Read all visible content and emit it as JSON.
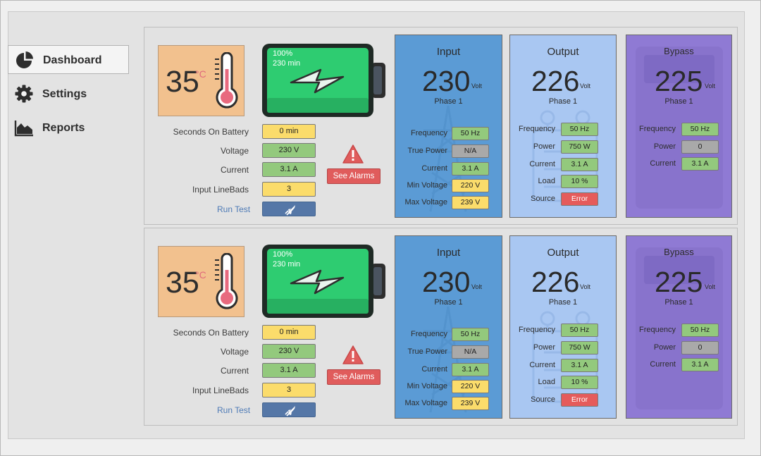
{
  "sidebar": {
    "items": [
      {
        "label": "Dashboard",
        "icon": "pie-chart-icon",
        "active": true
      },
      {
        "label": "Settings",
        "icon": "gear-icon",
        "active": false
      },
      {
        "label": "Reports",
        "icon": "area-chart-icon",
        "active": false
      }
    ]
  },
  "ups": [
    {
      "temperature": {
        "value": "35",
        "unit": "°C"
      },
      "battery": {
        "percent": "100%",
        "runtime": "230 min",
        "charge_fraction": 1.0
      },
      "stats": [
        {
          "label": "Seconds On Battery",
          "value": "0 min",
          "status": "yellow"
        },
        {
          "label": "Voltage",
          "value": "230 V",
          "status": "green"
        },
        {
          "label": "Current",
          "value": "3.1 A",
          "status": "green"
        },
        {
          "label": "Input LineBads",
          "value": "3",
          "status": "yellow"
        }
      ],
      "run_test": "Run Test",
      "alarms_label": "See Alarms",
      "input": {
        "title": "Input",
        "value": "230",
        "unit": "Volt",
        "phase": "Phase 1",
        "rows": [
          {
            "label": "Frequency",
            "value": "50 Hz",
            "status": "green"
          },
          {
            "label": "True Power",
            "value": "N/A",
            "status": "gray"
          },
          {
            "label": "Current",
            "value": "3.1 A",
            "status": "green"
          },
          {
            "label": "Min Voltage",
            "value": "220 V",
            "status": "yellow"
          },
          {
            "label": "Max Voltage",
            "value": "239 V",
            "status": "yellow"
          }
        ]
      },
      "output": {
        "title": "Output",
        "value": "226",
        "unit": "Volt",
        "phase": "Phase 1",
        "rows": [
          {
            "label": "Frequency",
            "value": "50 Hz",
            "status": "green"
          },
          {
            "label": "Power",
            "value": "750 W",
            "status": "green"
          },
          {
            "label": "Current",
            "value": "3.1 A",
            "status": "green"
          },
          {
            "label": "Load",
            "value": "10 %",
            "status": "green"
          },
          {
            "label": "Source",
            "value": "Error",
            "status": "red"
          }
        ]
      },
      "bypass": {
        "title": "Bypass",
        "value": "225",
        "unit": "Volt",
        "phase": "Phase 1",
        "rows": [
          {
            "label": "Frequency",
            "value": "50 Hz",
            "status": "green"
          },
          {
            "label": "Power",
            "value": "0",
            "status": "gray"
          },
          {
            "label": "Current",
            "value": "3.1 A",
            "status": "green"
          }
        ]
      }
    },
    {
      "temperature": {
        "value": "35",
        "unit": "°C"
      },
      "battery": {
        "percent": "100%",
        "runtime": "230 min",
        "charge_fraction": 1.0
      },
      "stats": [
        {
          "label": "Seconds On Battery",
          "value": "0 min",
          "status": "yellow"
        },
        {
          "label": "Voltage",
          "value": "230 V",
          "status": "green"
        },
        {
          "label": "Current",
          "value": "3.1 A",
          "status": "green"
        },
        {
          "label": "Input LineBads",
          "value": "3",
          "status": "yellow"
        }
      ],
      "run_test": "Run Test",
      "alarms_label": "See Alarms",
      "input": {
        "title": "Input",
        "value": "230",
        "unit": "Volt",
        "phase": "Phase 1",
        "rows": [
          {
            "label": "Frequency",
            "value": "50 Hz",
            "status": "green"
          },
          {
            "label": "True Power",
            "value": "N/A",
            "status": "gray"
          },
          {
            "label": "Current",
            "value": "3.1 A",
            "status": "green"
          },
          {
            "label": "Min Voltage",
            "value": "220 V",
            "status": "yellow"
          },
          {
            "label": "Max Voltage",
            "value": "239 V",
            "status": "yellow"
          }
        ]
      },
      "output": {
        "title": "Output",
        "value": "226",
        "unit": "Volt",
        "phase": "Phase 1",
        "rows": [
          {
            "label": "Frequency",
            "value": "50 Hz",
            "status": "green"
          },
          {
            "label": "Power",
            "value": "750 W",
            "status": "green"
          },
          {
            "label": "Current",
            "value": "3.1 A",
            "status": "green"
          },
          {
            "label": "Load",
            "value": "10 %",
            "status": "green"
          },
          {
            "label": "Source",
            "value": "Error",
            "status": "red"
          }
        ]
      },
      "bypass": {
        "title": "Bypass",
        "value": "225",
        "unit": "Volt",
        "phase": "Phase 1",
        "rows": [
          {
            "label": "Frequency",
            "value": "50 Hz",
            "status": "green"
          },
          {
            "label": "Power",
            "value": "0",
            "status": "gray"
          },
          {
            "label": "Current",
            "value": "3.1 A",
            "status": "green"
          }
        ]
      }
    }
  ],
  "colors": {
    "input_card": "#5b9bd5",
    "output_card": "#a9c7f2",
    "bypass_card": "#8f7ad4",
    "temperature_box": "#f2c18e",
    "battery_fill": "#2ecc71",
    "status_green": "#93c97d",
    "status_yellow": "#fbdc6b",
    "status_gray": "#a9a9a9",
    "status_red": "#e55b5b",
    "alarm_icon": "#e05c5c"
  }
}
